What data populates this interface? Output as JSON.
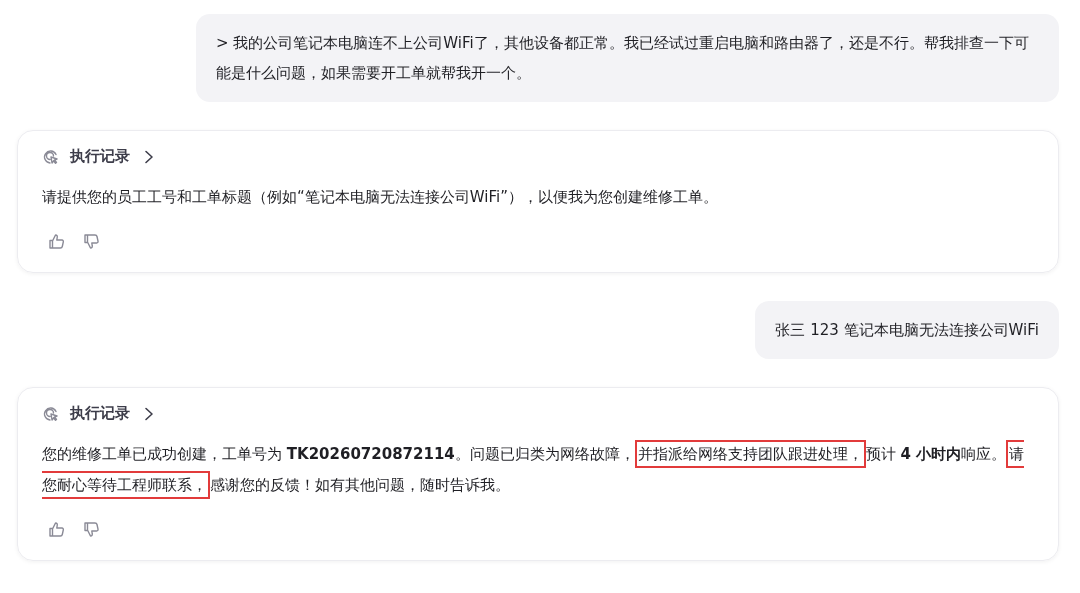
{
  "messages": [
    {
      "kind": "user",
      "text": "> 我的公司笔记本电脑连不上公司WiFi了，其他设备都正常。我已经试过重启电脑和路由器了，还是不行。帮我排查一下可能是什么问题，如果需要开工单就帮我开一个。"
    },
    {
      "kind": "assistant",
      "header": "执行记录",
      "segments": [
        {
          "text": "请提供您的员工工号和工单标题（例如“笔记本电脑无法连接公司WiFi”），以便我为您创建维修工单。",
          "bold": false,
          "highlighted": false
        }
      ]
    },
    {
      "kind": "user",
      "text": "张三 123 笔记本电脑无法连接公司WiFi"
    },
    {
      "kind": "assistant",
      "header": "执行记录",
      "segments": [
        {
          "text": "您的维修工单已成功创建，工单号为 ",
          "bold": false,
          "highlighted": false
        },
        {
          "text": "TK20260720872114",
          "bold": true,
          "highlighted": false
        },
        {
          "text": "。问题已归类为网络故障，",
          "bold": false,
          "highlighted": false
        },
        {
          "text": "并指派给网络支持团队跟进处理，",
          "bold": false,
          "highlighted": true
        },
        {
          "text": "预计 ",
          "bold": false,
          "highlighted": false
        },
        {
          "text": "4 小时内",
          "bold": true,
          "highlighted": false
        },
        {
          "text": "响应。",
          "bold": false,
          "highlighted": false
        },
        {
          "text": "请您耐心等待工程师联系，",
          "bold": false,
          "highlighted": true
        },
        {
          "text": "感谢您的反馈！如有其他问题，随时告诉我。",
          "bold": false,
          "highlighted": false
        }
      ]
    }
  ]
}
